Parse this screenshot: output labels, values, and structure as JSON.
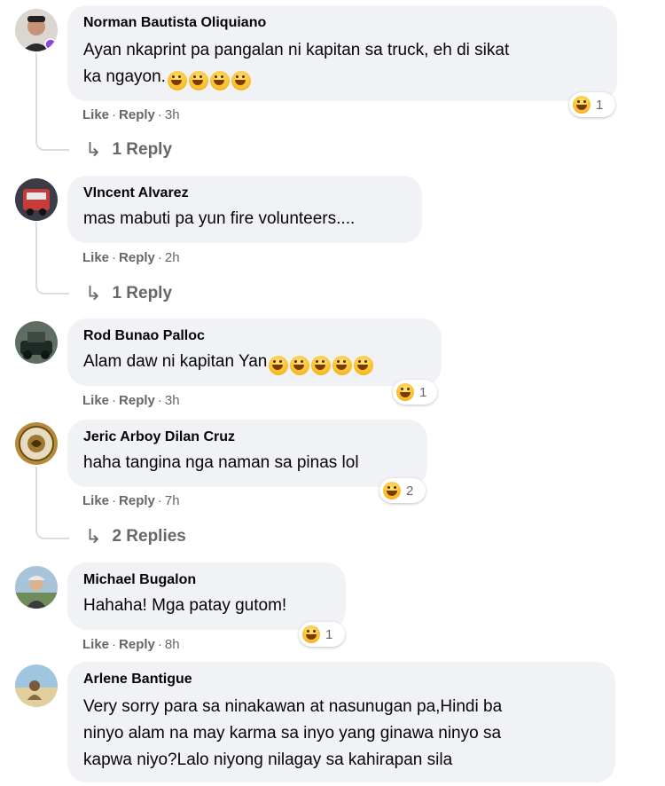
{
  "comments": [
    {
      "author": "Norman Bautista Oliquiano",
      "text": "Ayan nkaprint pa pangalan ni kapitan sa truck, eh di sikat",
      "text2": "ka ngayon.",
      "like": "Like",
      "reply": "Reply",
      "time": "3h",
      "reactions": "1",
      "replies": "1 Reply"
    },
    {
      "author": "VIncent Alvarez",
      "text": "mas mabuti pa yun fire volunteers....",
      "like": "Like",
      "reply": "Reply",
      "time": "2h",
      "replies": "1 Reply"
    },
    {
      "author": "Rod Bunao Palloc",
      "text": "Alam daw ni kapitan Yan",
      "like": "Like",
      "reply": "Reply",
      "time": "3h",
      "reactions": "1"
    },
    {
      "author": "Jeric Arboy Dilan Cruz",
      "text": "haha tangina nga naman sa pinas lol",
      "like": "Like",
      "reply": "Reply",
      "time": "7h",
      "reactions": "2",
      "replies": "2 Replies"
    },
    {
      "author": "Michael Bugalon",
      "text": "Hahaha! Mga patay gutom!",
      "like": "Like",
      "reply": "Reply",
      "time": "8h",
      "reactions": "1"
    },
    {
      "author": "Arlene Bantigue",
      "line1": "Very sorry para sa ninakawan at nasunugan pa,Hindi ba",
      "line2": "ninyo alam na may karma sa inyo yang ginawa ninyo sa",
      "line3": "kapwa niyo?Lalo niyong nilagay sa kahirapan sila"
    }
  ],
  "icons": {
    "reaction": "haha-emoji-icon",
    "reply_arrow": "reply-arrow-icon"
  },
  "colors": {
    "bubble": "#f0f2f5",
    "muted": "#65676b",
    "reaction_yellow": "#fbc02d"
  }
}
